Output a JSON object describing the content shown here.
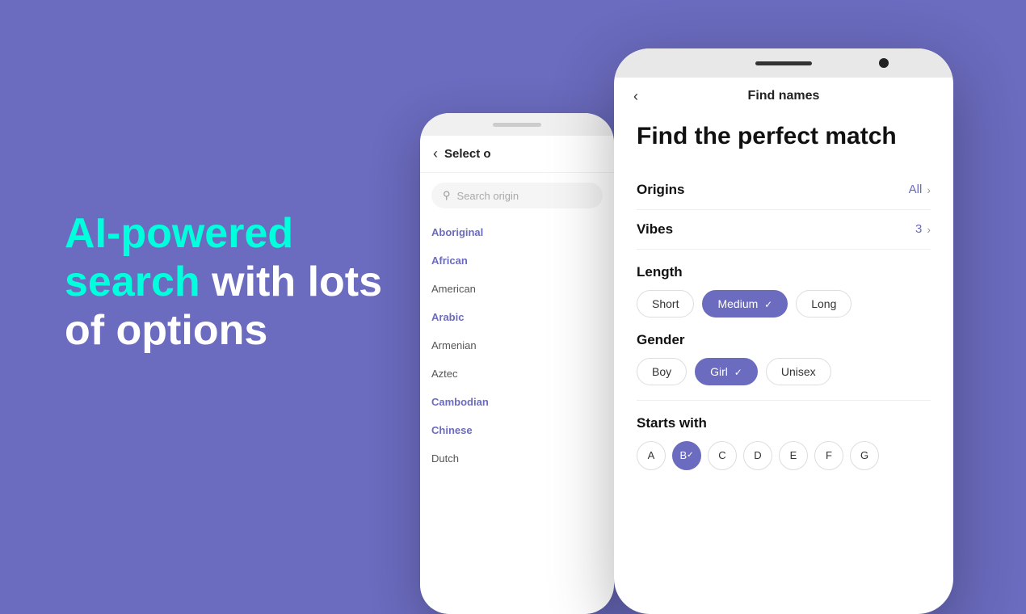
{
  "background": "#6B6BBF",
  "hero": {
    "line1_plain": "AI-powered",
    "line1_highlight": "search",
    "line2": "with lots",
    "line3": "of options"
  },
  "phone_back": {
    "notch": true,
    "header": {
      "back_arrow": "‹",
      "title": "Select o"
    },
    "search": {
      "placeholder": "Search origin"
    },
    "origins": [
      {
        "label": "Aboriginal",
        "selected": true
      },
      {
        "label": "African",
        "selected": true
      },
      {
        "label": "American",
        "selected": false
      },
      {
        "label": "Arabic",
        "selected": true
      },
      {
        "label": "Armenian",
        "selected": false
      },
      {
        "label": "Aztec",
        "selected": false
      },
      {
        "label": "Cambodian",
        "selected": true
      },
      {
        "label": "Chinese",
        "selected": true
      },
      {
        "label": "Dutch",
        "selected": false
      }
    ]
  },
  "phone_front": {
    "header": {
      "back_arrow": "‹",
      "title": "Find names"
    },
    "main_heading": "Find the perfect match",
    "filters": [
      {
        "label": "Origins",
        "value": "All",
        "arrow": "›"
      },
      {
        "label": "Vibes",
        "value": "3",
        "arrow": "›"
      }
    ],
    "length": {
      "title": "Length",
      "options": [
        {
          "label": "Short",
          "selected": false
        },
        {
          "label": "Medium",
          "selected": true
        },
        {
          "label": "Long",
          "selected": false
        }
      ]
    },
    "gender": {
      "title": "Gender",
      "options": [
        {
          "label": "Boy",
          "selected": false
        },
        {
          "label": "Girl",
          "selected": true
        },
        {
          "label": "Unisex",
          "selected": false
        }
      ]
    },
    "starts_with": {
      "title": "Starts with",
      "letters": [
        {
          "label": "A",
          "selected": false
        },
        {
          "label": "B",
          "selected": true
        },
        {
          "label": "C",
          "selected": false
        },
        {
          "label": "D",
          "selected": false
        },
        {
          "label": "E",
          "selected": false
        },
        {
          "label": "F",
          "selected": false
        },
        {
          "label": "G",
          "selected": false
        }
      ]
    }
  }
}
